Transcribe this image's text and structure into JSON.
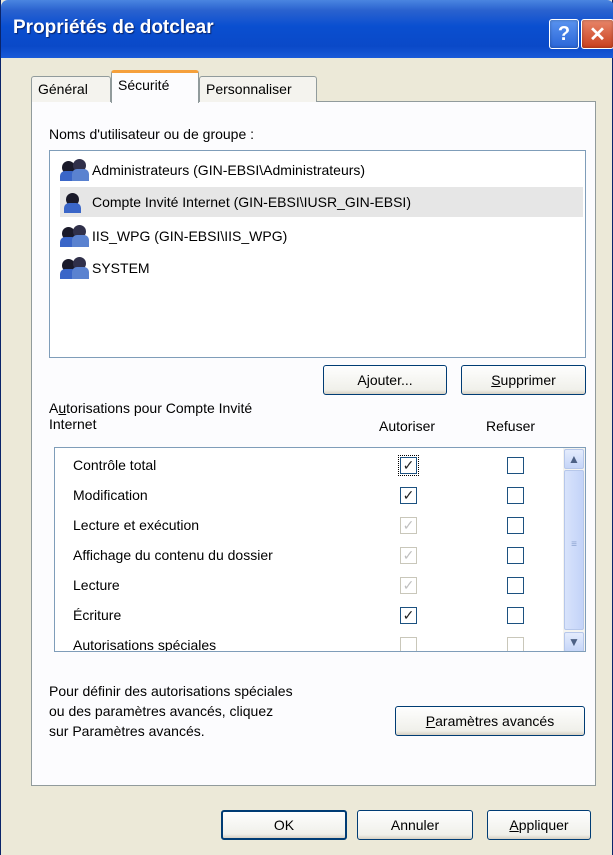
{
  "window": {
    "title": "Propriétés de dotclear",
    "help_label": "?",
    "close_label": "✕"
  },
  "tabs": [
    {
      "label": "Général",
      "active": false
    },
    {
      "label": "Sécurité",
      "active": true
    },
    {
      "label": "Personnaliser",
      "active": false
    }
  ],
  "users": {
    "label_prefix": "Noms d'utilisateur ou de ",
    "label_underline": "g",
    "label_suffix": "roupe :",
    "items": [
      {
        "name": "Administrateurs (GIN-EBSI\\Administrateurs)",
        "icon": "group-users-icon",
        "selected": false
      },
      {
        "name": "Compte Invité Internet (GIN-EBSI\\IUSR_GIN-EBSI)",
        "icon": "user-icon",
        "selected": true
      },
      {
        "name": "IIS_WPG (GIN-EBSI\\IIS_WPG)",
        "icon": "group-users-icon",
        "selected": false
      },
      {
        "name": "SYSTEM",
        "icon": "group-users-icon",
        "selected": false
      }
    ]
  },
  "buttons": {
    "add_pre": "A",
    "add_u": "j",
    "add_post": "outer...",
    "remove_u": "S",
    "remove_post": "upprimer",
    "advanced_u": "P",
    "advanced_post": "aramètres avancés",
    "ok": "OK",
    "cancel": "Annuler",
    "apply_u": "A",
    "apply_post": "ppliquer"
  },
  "permissions": {
    "label_pre": "A",
    "label_u": "u",
    "label_line1": "torisations pour Compte Invité",
    "label_line2": "Internet",
    "allow_header": "Autoriser",
    "deny_header": "Refuser",
    "rows": [
      {
        "name": "Contrôle total",
        "allow": "checked",
        "deny": "unchecked",
        "focused": true
      },
      {
        "name": "Modification",
        "allow": "checked",
        "deny": "unchecked"
      },
      {
        "name": "Lecture et exécution",
        "allow": "checked-disabled",
        "deny": "unchecked"
      },
      {
        "name": "Affichage du contenu du dossier",
        "allow": "checked-disabled",
        "deny": "unchecked"
      },
      {
        "name": "Lecture",
        "allow": "checked-disabled",
        "deny": "unchecked"
      },
      {
        "name": "Écriture",
        "allow": "checked",
        "deny": "unchecked"
      },
      {
        "name": "Autorisations spéciales",
        "allow": "unchecked-disabled",
        "deny": "unchecked-disabled"
      }
    ]
  },
  "advanced_note": {
    "line1": "Pour définir des autorisations spéciales",
    "line2": "ou des paramètres avancés, cliquez",
    "line3": "sur Paramètres avancés."
  },
  "colors": {
    "titlebar": "#0a4fd0",
    "tab_highlight": "#f5a03c",
    "dialog_bg": "#ece9d8"
  }
}
